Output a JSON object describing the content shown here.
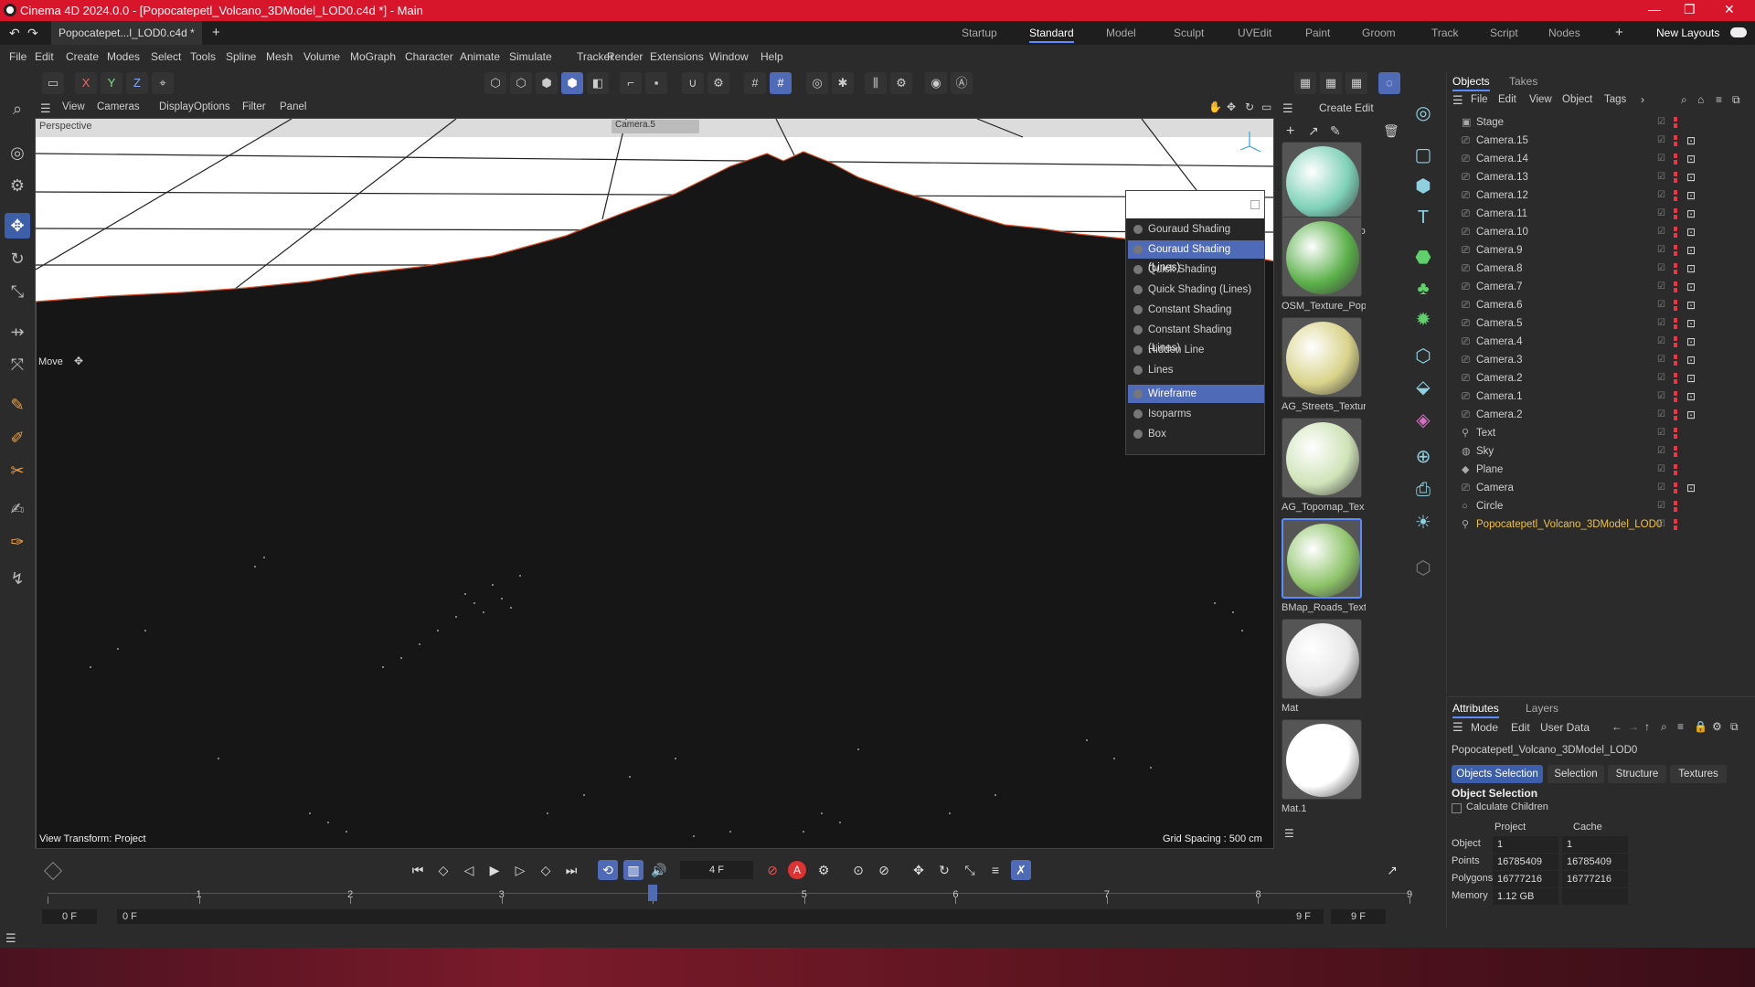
{
  "window": {
    "title": "Cinema 4D 2024.0.0 - [Popocatepetl_Volcano_3DModel_LOD0.c4d *] - Main"
  },
  "doc_tab": {
    "label": "Popocatepet...l_LOD0.c4d *"
  },
  "layouts": [
    "Startup",
    "Standard",
    "Model",
    "Sculpt",
    "UVEdit",
    "Paint",
    "Groom",
    "Track",
    "Script",
    "Nodes"
  ],
  "active_layout": "Standard",
  "new_layouts_label": "New Layouts",
  "menu": [
    "File",
    "Edit",
    "Create",
    "Modes",
    "Select",
    "Tools",
    "Spline",
    "Mesh",
    "Volume",
    "MoGraph",
    "Character",
    "Animate",
    "Simulate",
    "Tracker",
    "Render",
    "Extensions",
    "Window",
    "Help"
  ],
  "toolbar_axes": [
    "X",
    "Y",
    "Z"
  ],
  "viewport_menu": [
    "View",
    "Cameras",
    "Display",
    "Options",
    "Filter",
    "Panel"
  ],
  "viewport": {
    "label": "Perspective",
    "camera_label": "Camera.5",
    "tool_label": "Move",
    "view_transform": "View Transform: Project",
    "grid_spacing": "Grid Spacing : 500 cm"
  },
  "display_menu": {
    "items": [
      "Gouraud Shading",
      "Gouraud Shading (Lines)",
      "Quick Shading",
      "Quick Shading (Lines)",
      "Constant Shading",
      "Constant Shading (Lines)",
      "Hidden Line",
      "Lines",
      "Wireframe",
      "Isoparms",
      "Box"
    ],
    "active": [
      "Gouraud Shading (Lines)",
      "Wireframe"
    ]
  },
  "material_browser": {
    "menu": [
      "Create",
      "Edit"
    ],
    "materials": [
      {
        "name": "GMap_Texture_Po",
        "color": "#7ed1b8"
      },
      {
        "name": "OSM_Texture_Pop",
        "color": "#5bb04a"
      },
      {
        "name": "AG_Streets_Textur",
        "color": "#d9d38a"
      },
      {
        "name": "AG_Topomap_Tex",
        "color": "#cfe3b8"
      },
      {
        "name": "BMap_Roads_Text",
        "color": "#8fc46a"
      },
      {
        "name": "Mat",
        "color": "#e8e8e8"
      },
      {
        "name": "Mat.1",
        "color": "#ffffff"
      }
    ],
    "selected": "BMap_Roads_Text"
  },
  "objects_panel": {
    "tabs": [
      "Objects",
      "Takes"
    ],
    "menu": [
      "File",
      "Edit",
      "View",
      "Object",
      "Tags"
    ],
    "items": [
      {
        "name": "Stage",
        "icon": "stage-icon"
      },
      {
        "name": "Camera.15",
        "icon": "camera-icon"
      },
      {
        "name": "Camera.14",
        "icon": "camera-icon"
      },
      {
        "name": "Camera.13",
        "icon": "camera-icon"
      },
      {
        "name": "Camera.12",
        "icon": "camera-icon"
      },
      {
        "name": "Camera.11",
        "icon": "camera-icon"
      },
      {
        "name": "Camera.10",
        "icon": "camera-icon"
      },
      {
        "name": "Camera.9",
        "icon": "camera-icon"
      },
      {
        "name": "Camera.8",
        "icon": "camera-icon"
      },
      {
        "name": "Camera.7",
        "icon": "camera-icon"
      },
      {
        "name": "Camera.6",
        "icon": "camera-icon"
      },
      {
        "name": "Camera.5",
        "icon": "camera-icon"
      },
      {
        "name": "Camera.4",
        "icon": "camera-icon"
      },
      {
        "name": "Camera.3",
        "icon": "camera-icon"
      },
      {
        "name": "Camera.2",
        "icon": "camera-icon"
      },
      {
        "name": "Camera.1",
        "icon": "camera-icon"
      },
      {
        "name": "Camera.2",
        "icon": "camera-icon"
      },
      {
        "name": "Text",
        "icon": "text-icon"
      },
      {
        "name": "Sky",
        "icon": "sky-icon"
      },
      {
        "name": "Plane",
        "icon": "plane-icon"
      },
      {
        "name": "Camera",
        "icon": "camera-icon"
      },
      {
        "name": "Circle",
        "icon": "circle-icon"
      },
      {
        "name": "Popocatepetl_Volcano_3DModel_LOD0",
        "icon": "polygon-icon",
        "highlight": "#f0c040"
      }
    ]
  },
  "attributes": {
    "tabs": [
      "Attributes",
      "Layers"
    ],
    "menu": [
      "Mode",
      "Edit",
      "User Data"
    ],
    "object_name": "Popocatepetl_Volcano_3DModel_LOD0",
    "subtabs": [
      "Objects Selection",
      "Selection",
      "Structure",
      "Textures"
    ],
    "section_title": "Object Selection",
    "calc_children": "Calculate Children",
    "col_project": "Project",
    "col_cache": "Cache",
    "rows": [
      {
        "label": "Object",
        "project": "1",
        "cache": "1"
      },
      {
        "label": "Points",
        "project": "16785409",
        "cache": "16785409"
      },
      {
        "label": "Polygons",
        "project": "16777216",
        "cache": "16777216"
      },
      {
        "label": "Memory",
        "project": "1.12 GB",
        "cache": ""
      }
    ]
  },
  "timeline": {
    "current_frame": "4 F",
    "start": "0 F",
    "start2": "0 F",
    "end": "9 F",
    "end2": "9 F",
    "ticks": [
      "0",
      "1",
      "2",
      "3",
      "4",
      "5",
      "6",
      "7",
      "8",
      "9"
    ],
    "playhead_frame": 4
  },
  "colors": {
    "accent": "#4f6ab7",
    "titlebar": "#d7152b"
  }
}
